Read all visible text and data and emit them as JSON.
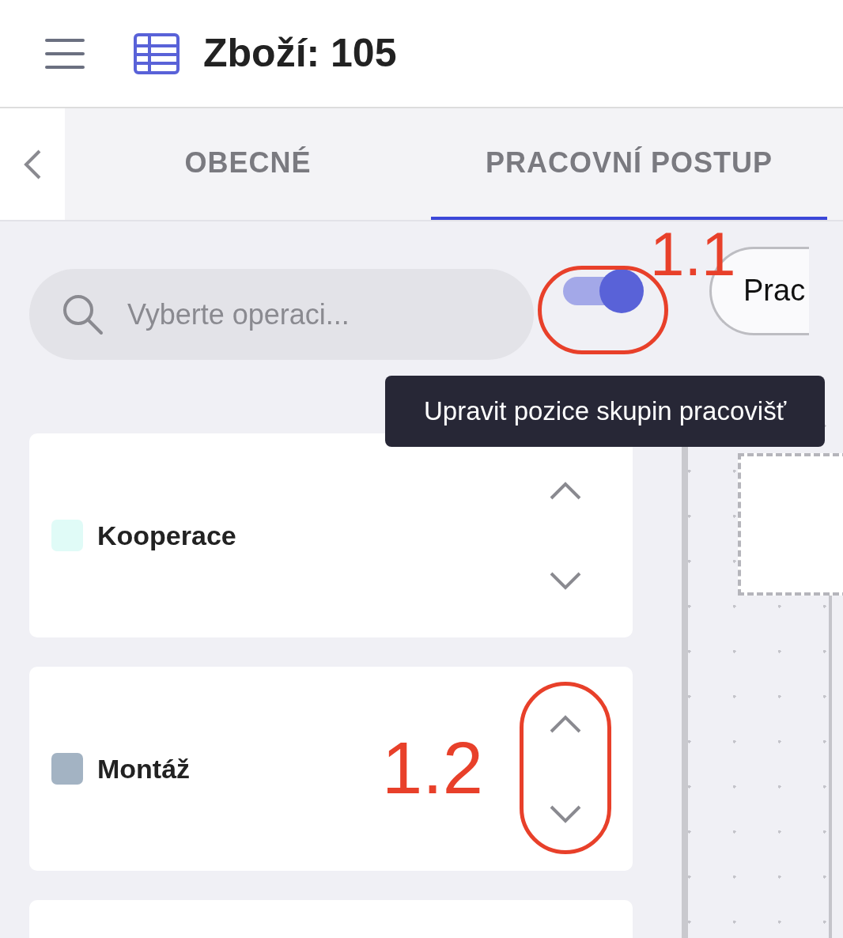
{
  "header": {
    "title": "Zboží: 105"
  },
  "tabs": [
    {
      "label": "OBECNÉ",
      "selected": false
    },
    {
      "label": "PRACOVNÍ POSTUP",
      "selected": true
    }
  ],
  "search": {
    "placeholder": "Vyberte operaci..."
  },
  "edit_toggle": {
    "on": true
  },
  "tooltip": "Upravit pozice skupin pracovišť",
  "side_button": "Prac",
  "groups": [
    {
      "name": "Kooperace",
      "color": "#e0fbf7"
    },
    {
      "name": "Montáž",
      "color": "#a3b3c3"
    }
  ],
  "annotations": [
    {
      "label": "1.1"
    },
    {
      "label": "1.2"
    }
  ]
}
